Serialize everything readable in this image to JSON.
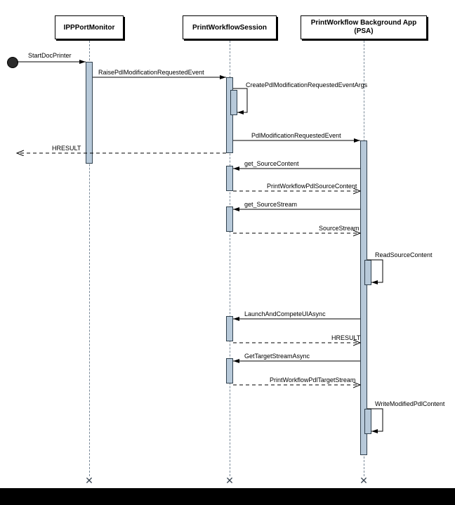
{
  "diagram": {
    "participants": {
      "p1": "IPPPortMonitor",
      "p2": "PrintWorkflowSession",
      "p3": "PrintWorkflow Background App\n(PSA)"
    },
    "messages": {
      "startDoc": "StartDocPrinter",
      "raise": "RaisePdlModificationRequestedEvent",
      "createArgs": "CreatePdlModificationRequestedEventArgs",
      "pdlEvent": "PdlModificationRequestedEvent",
      "hresult1": "HRESULT",
      "getSourceContent": "get_SourceContent",
      "pwfSourceContent": "PrintWorkflowPdlSourceContent",
      "getSourceStream": "get_SourceStream",
      "sourceStream": "SourceStream",
      "readSource": "ReadSourceContent",
      "launchUI": "LaunchAndCompeteUIAsync",
      "hresult2": "HRESULT",
      "getTarget": "GetTargetStreamAsync",
      "pwfTargetStream": "PrintWorkflowPdlTargetStream",
      "writeModified": "WriteModifiedPdlContent"
    }
  }
}
